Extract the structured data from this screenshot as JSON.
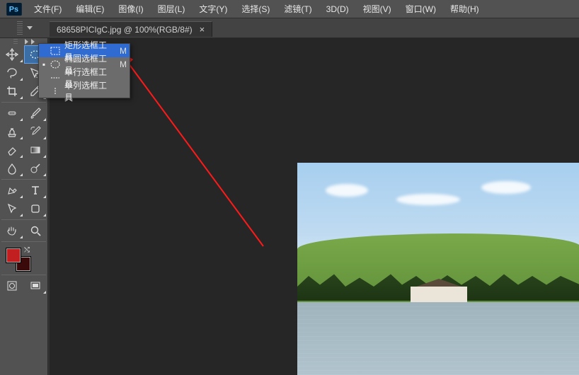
{
  "app": {
    "name": "Ps"
  },
  "menu": {
    "items": [
      "文件(F)",
      "编辑(E)",
      "图像(I)",
      "图层(L)",
      "文字(Y)",
      "选择(S)",
      "滤镜(T)",
      "3D(D)",
      "视图(V)",
      "窗口(W)",
      "帮助(H)"
    ]
  },
  "tab": {
    "title": "68658PICIgC.jpg @ 100%(RGB/8#)",
    "close": "×"
  },
  "tools": {
    "names": [
      "move-tool",
      "marquee-tool",
      "lasso-tool",
      "quick-select-tool",
      "eyedropper-tool",
      "crop-tool",
      "spot-heal-tool",
      "brush-tool",
      "clone-stamp-tool",
      "history-brush-tool",
      "eraser-tool",
      "gradient-tool",
      "blur-tool",
      "dodge-tool",
      "pen-tool",
      "type-tool",
      "path-select-tool",
      "shape-tool",
      "hand-tool",
      "zoom-tool"
    ]
  },
  "flyout": {
    "items": [
      {
        "label": "矩形选框工具",
        "key": "M",
        "highlighted": true,
        "current": false,
        "icon": "rect-marquee-icon"
      },
      {
        "label": "椭圆选框工具",
        "key": "M",
        "highlighted": false,
        "current": true,
        "icon": "ellipse-marquee-icon"
      },
      {
        "label": "单行选框工具",
        "key": "",
        "highlighted": false,
        "current": false,
        "icon": "row-marquee-icon"
      },
      {
        "label": "单列选框工具",
        "key": "",
        "highlighted": false,
        "current": false,
        "icon": "col-marquee-icon"
      }
    ]
  },
  "colors": {
    "fg": "#c22020",
    "bg": "#3a0a0a"
  }
}
